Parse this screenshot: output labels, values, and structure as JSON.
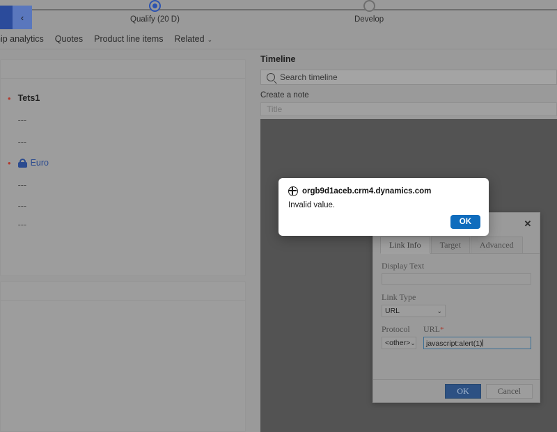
{
  "process_bar": {
    "back_icon": "back-arrow-icon",
    "collapse_icon": "chevron-left-icon",
    "stages": [
      {
        "label": "Qualify  (20 D)",
        "state": "active"
      },
      {
        "label": "Develop",
        "state": "idle"
      }
    ]
  },
  "tabs": [
    {
      "label": "hip analytics",
      "has_chevron": false
    },
    {
      "label": "Quotes",
      "has_chevron": false
    },
    {
      "label": "Product line items",
      "has_chevron": false
    },
    {
      "label": "Related",
      "has_chevron": true,
      "chevron": "⌄"
    }
  ],
  "form": {
    "fields": [
      {
        "required": true,
        "value": "Tets1",
        "style": "bold"
      },
      {
        "required": false,
        "value": "---",
        "style": "dim"
      },
      {
        "required": false,
        "value": "---",
        "style": "dim"
      },
      {
        "required": true,
        "value": "Euro",
        "style": "link",
        "icon": "lock-icon"
      },
      {
        "required": false,
        "value": "---",
        "style": "dim"
      },
      {
        "required": false,
        "value": "---",
        "style": "dim"
      },
      {
        "required": false,
        "value": "---",
        "style": "dim"
      }
    ]
  },
  "timeline": {
    "title": "Timeline",
    "search_placeholder": "Search timeline",
    "search_icon": "search-icon",
    "note_label": "Create a note",
    "note_title_placeholder": "Title"
  },
  "link_dialog": {
    "close_label": "✕",
    "tabs": [
      {
        "label": "Link Info",
        "selected": true
      },
      {
        "label": "Target",
        "selected": false
      },
      {
        "label": "Advanced",
        "selected": false
      }
    ],
    "display_text_label": "Display Text",
    "display_text_value": "",
    "link_type_label": "Link Type",
    "link_type_value": "URL",
    "protocol_label": "Protocol",
    "protocol_value": "<other>",
    "url_label": "URL",
    "url_required_mark": "*",
    "url_value": "javascript:alert(1)",
    "ok_label": "OK",
    "cancel_label": "Cancel"
  },
  "alert": {
    "origin_icon": "globe-icon",
    "origin": "orgb9d1aceb.crm4.dynamics.com",
    "message": "Invalid value.",
    "ok_label": "OK"
  },
  "colors": {
    "dim_overlay": "#9a9a9a",
    "editor_overlay": "#535353",
    "accent_blue": "#2b52b0",
    "alert_button": "#0f6cbd",
    "dialog_primary": "#2d5183",
    "required_red": "#b33a2e"
  }
}
